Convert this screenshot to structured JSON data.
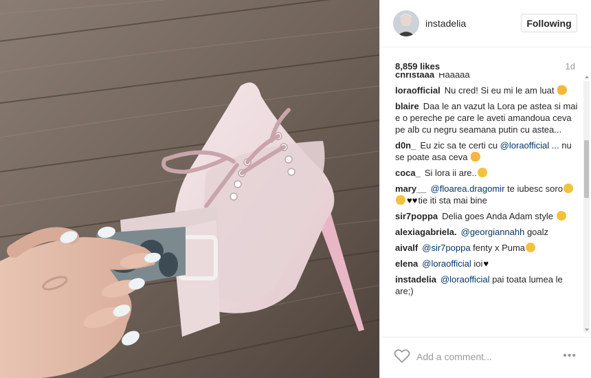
{
  "post": {
    "username": "instadelia",
    "follow_label": "Following",
    "likes": "8,859 likes",
    "age": "1d",
    "image_description": ""
  },
  "comments": [
    {
      "user": "christaaa",
      "parts": [
        {
          "t": "text",
          "v": "Haaaaa "
        }
      ]
    },
    {
      "user": "loraofficial",
      "parts": [
        {
          "t": "text",
          "v": "Nu cred! Si eu mi le am luat "
        },
        {
          "t": "emoji",
          "v": "hand"
        }
      ]
    },
    {
      "user": "blaire",
      "parts": [
        {
          "t": "text",
          "v": "Daa le an vazut la Lora pe astea si mai e o pereche pe care le aveti amandoua ceva pe alb cu negru seamana putin cu astea..."
        }
      ]
    },
    {
      "user": "d0n_",
      "parts": [
        {
          "t": "text",
          "v": "Eu zic sa te certi cu "
        },
        {
          "t": "mention",
          "v": "@loraofficial"
        },
        {
          "t": "text",
          "v": " ... nu se poate asa ceva "
        },
        {
          "t": "emoji",
          "v": "hand"
        }
      ]
    },
    {
      "user": "coca_",
      "parts": [
        {
          "t": "text",
          "v": "Si lora ii are.."
        },
        {
          "t": "emoji",
          "v": "face"
        }
      ]
    },
    {
      "user": "mary__",
      "parts": [
        {
          "t": "mention",
          "v": "@floarea.dragomir"
        },
        {
          "t": "text",
          "v": " te iubesc soro"
        },
        {
          "t": "emoji",
          "v": "face"
        },
        {
          "t": "emoji",
          "v": "face"
        },
        {
          "t": "heart",
          "v": "♥♥"
        },
        {
          "t": "text",
          "v": "tie iti sta mai bine"
        }
      ]
    },
    {
      "user": "sir7poppa",
      "parts": [
        {
          "t": "text",
          "v": "Delia goes Anda Adam style "
        },
        {
          "t": "emoji",
          "v": "face"
        }
      ]
    },
    {
      "user": "alexiagabriela.",
      "parts": [
        {
          "t": "mention",
          "v": "@georgiannahh"
        },
        {
          "t": "text",
          "v": " goalz"
        }
      ]
    },
    {
      "user": "aivalf",
      "parts": [
        {
          "t": "mention",
          "v": "@sir7poppa"
        },
        {
          "t": "text",
          "v": " fenty x Puma"
        },
        {
          "t": "emoji",
          "v": "face"
        }
      ]
    },
    {
      "user": "elena",
      "parts": [
        {
          "t": "mention",
          "v": "@loraofficial"
        },
        {
          "t": "text",
          "v": " ioi"
        },
        {
          "t": "heart",
          "v": "♥"
        }
      ]
    },
    {
      "user": "instadelia",
      "parts": [
        {
          "t": "mention",
          "v": "@loraofficial"
        },
        {
          "t": "text",
          "v": " pai toata lumea le are;)"
        }
      ]
    }
  ],
  "input": {
    "placeholder": "Add a comment..."
  },
  "icons": {
    "like": "heart-outline-icon",
    "more": "more-options-icon"
  },
  "colors": {
    "mention": "#003569",
    "border": "#efefef",
    "muted": "#999999"
  }
}
